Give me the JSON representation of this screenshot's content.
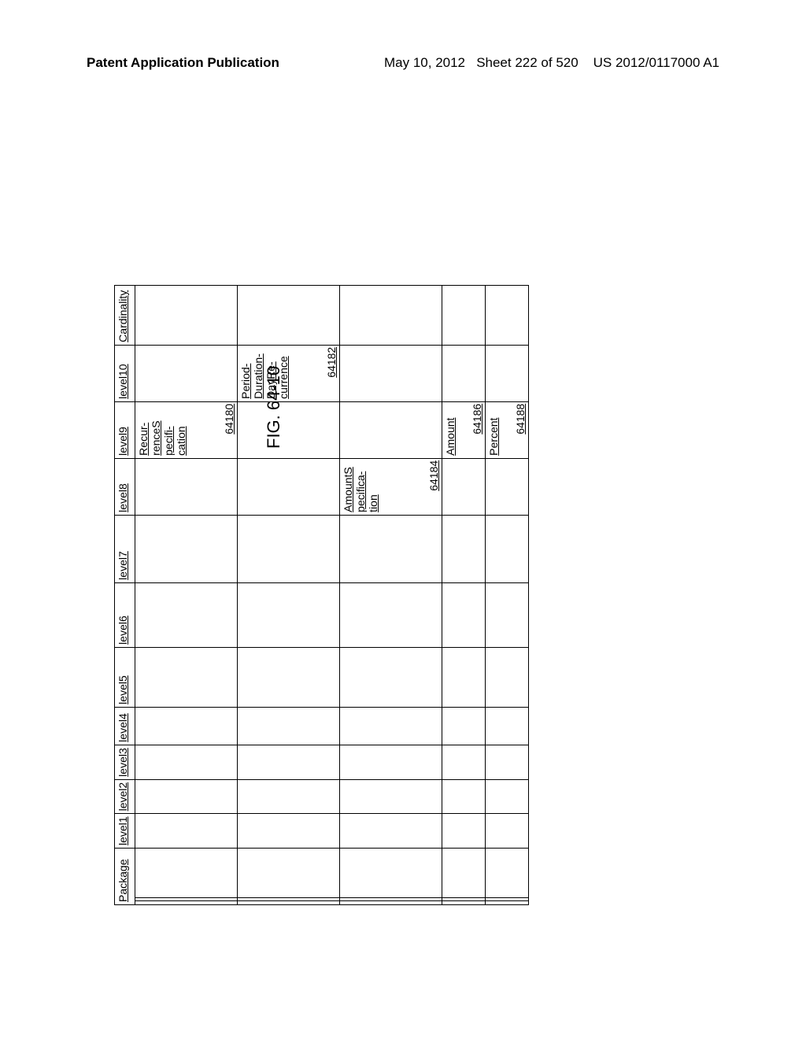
{
  "header": {
    "left": "Patent Application Publication",
    "right_date": "May 10, 2012",
    "right_sheet": "Sheet 222 of 520",
    "right_pubnum": "US 2012/0117000 A1"
  },
  "figure_title": "FIG. 64-10",
  "table": {
    "headers": [
      "Package",
      "level1",
      "level2",
      "level3",
      "level4",
      "level5",
      "level6",
      "level7",
      "level8",
      "level9",
      "level10",
      "Cardinality"
    ],
    "rows": [
      {
        "level9": {
          "text": "Recur-\nrenceS\npecifi-\ncation",
          "ref": "64180"
        }
      },
      {
        "level10": {
          "text": "Period-\nDuration-\nDayRe-\ncurrence",
          "ref": "64182"
        }
      },
      {
        "level8": {
          "text": "AmountS\npecifica-\ntion",
          "ref": "64184"
        }
      },
      {
        "level9": {
          "text": "Amount",
          "ref": "64186"
        },
        "short": true
      },
      {
        "level9": {
          "text": "Percent",
          "ref": "64188"
        },
        "short": true
      }
    ]
  }
}
